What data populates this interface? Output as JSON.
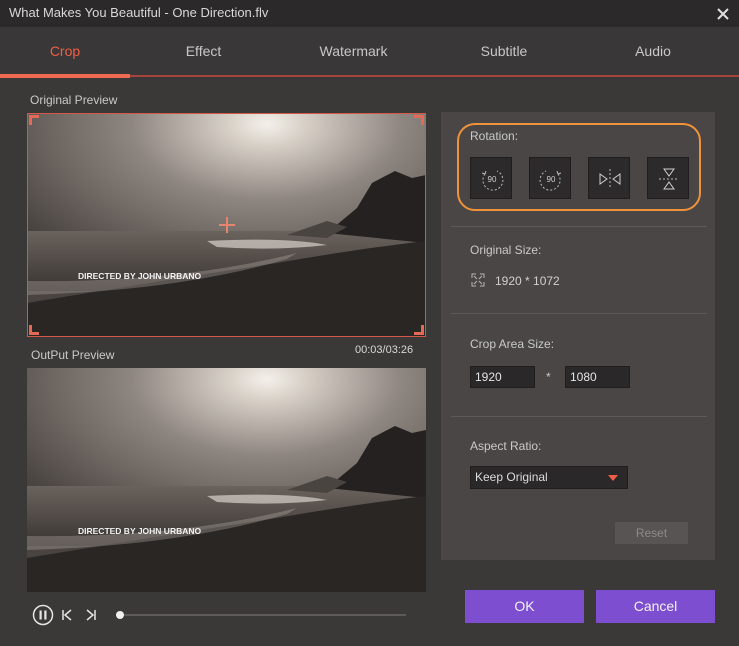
{
  "window": {
    "title": "What Makes You Beautiful - One Direction.flv"
  },
  "tabs": [
    {
      "label": "Crop",
      "active": true
    },
    {
      "label": "Effect",
      "active": false
    },
    {
      "label": "Watermark",
      "active": false
    },
    {
      "label": "Subtitle",
      "active": false
    },
    {
      "label": "Audio",
      "active": false
    }
  ],
  "preview": {
    "original_label": "Original Preview",
    "output_label": "OutPut Preview",
    "time": "00:03/03:26",
    "overlay_text": "DIRECTED BY JOHN URBANO",
    "progress_fraction": 0.015
  },
  "rotation": {
    "label": "Rotation:",
    "buttons": [
      {
        "name": "rotate-left",
        "text": "90"
      },
      {
        "name": "rotate-right",
        "text": "90"
      },
      {
        "name": "flip-horizontal",
        "text": ""
      },
      {
        "name": "flip-vertical",
        "text": ""
      }
    ]
  },
  "original_size": {
    "label": "Original Size:",
    "value": "1920 * 1072"
  },
  "crop_area": {
    "label": "Crop Area Size:",
    "width": "1920",
    "separator": "*",
    "height": "1080"
  },
  "aspect_ratio": {
    "label": "Aspect Ratio:",
    "selected": "Keep Original"
  },
  "buttons": {
    "reset": "Reset",
    "ok": "OK",
    "cancel": "Cancel"
  },
  "colors": {
    "accent": "#ef5f46",
    "primary_button": "#7d4ecf",
    "highlight": "#f0923a"
  }
}
